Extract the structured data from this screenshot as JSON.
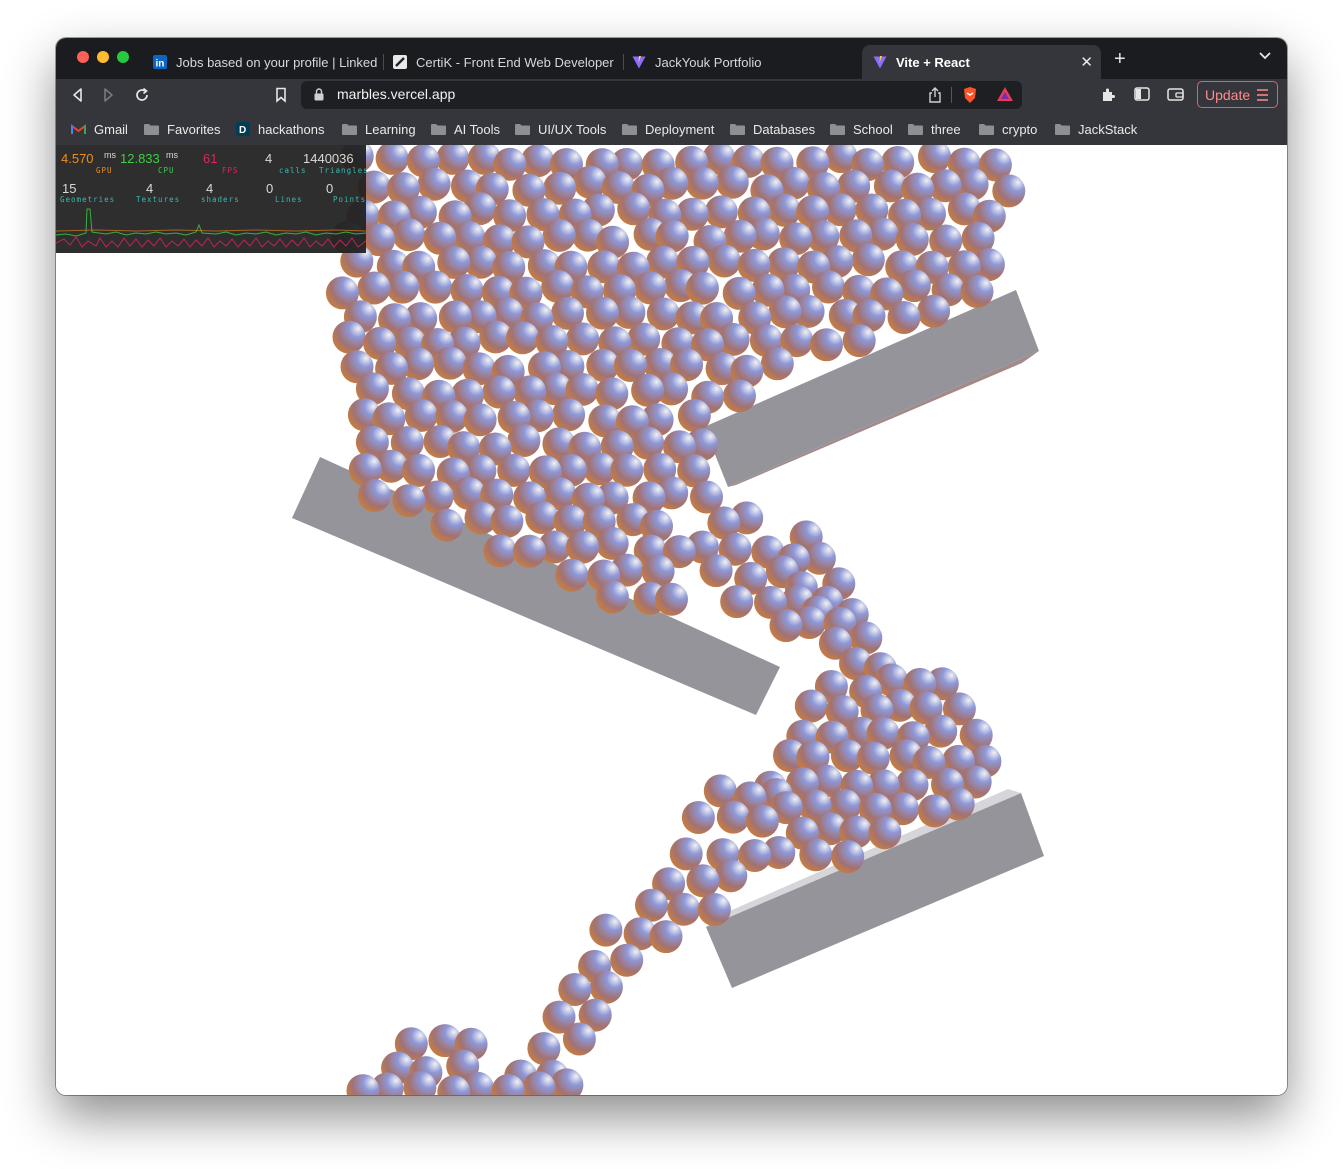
{
  "browser": {
    "tabs": [
      {
        "title": "Jobs based on your profile | LinkedIn",
        "icon": "linkedin-icon",
        "active": false
      },
      {
        "title": "CertiK - Front End Web Developer - ",
        "icon": "certik-icon",
        "active": false
      },
      {
        "title": "JackYouk Portfolio",
        "icon": "vite-icon",
        "active": false
      },
      {
        "title": "Vite + React",
        "icon": "vite-icon",
        "active": true
      }
    ],
    "url": "marbles.vercel.app",
    "update_label": "Update",
    "bookmarks": [
      {
        "label": "Gmail",
        "icon": "gmail-icon"
      },
      {
        "label": "Favorites",
        "icon": "folder-icon"
      },
      {
        "label": "hackathons",
        "icon": "devpost-icon"
      },
      {
        "label": "Learning",
        "icon": "folder-icon"
      },
      {
        "label": "AI Tools",
        "icon": "folder-icon"
      },
      {
        "label": "UI/UX Tools",
        "icon": "folder-icon"
      },
      {
        "label": "Deployment",
        "icon": "folder-icon"
      },
      {
        "label": "Databases",
        "icon": "folder-icon"
      },
      {
        "label": "School",
        "icon": "folder-icon"
      },
      {
        "label": "three",
        "icon": "folder-icon"
      },
      {
        "label": "crypto",
        "icon": "folder-icon"
      },
      {
        "label": "JackStack",
        "icon": "folder-icon"
      }
    ]
  },
  "stats": {
    "gpu": {
      "value": "4.570",
      "unit": "ms",
      "label": "GPU"
    },
    "cpu": {
      "value": "12.833",
      "unit": "ms",
      "label": "CPU"
    },
    "fps": {
      "value": "61",
      "label": "FPS"
    },
    "calls": {
      "value": "4",
      "label": "calls"
    },
    "triangles": {
      "value": "1440036",
      "label": "Triangles"
    },
    "geometries": {
      "value": "15",
      "label": "Geometries"
    },
    "textures": {
      "value": "4",
      "label": "Textures"
    },
    "shaders": {
      "value": "4",
      "label": "shaders"
    },
    "lines": {
      "value": "0",
      "label": "Lines"
    },
    "points": {
      "value": "0",
      "label": "Points"
    }
  },
  "colors": {
    "gpu": "#f08c1e",
    "cpu": "#3ccf43",
    "fps": "#e0245e",
    "stat_text": "#d9d9d9",
    "stat_label": "#3fb6b0",
    "plank": "#96949b",
    "marble_light": "#7a86cf",
    "marble_dark": "#c27a3c"
  },
  "scene": {
    "object_counts": {
      "marbles": 560,
      "planks": 3
    }
  }
}
